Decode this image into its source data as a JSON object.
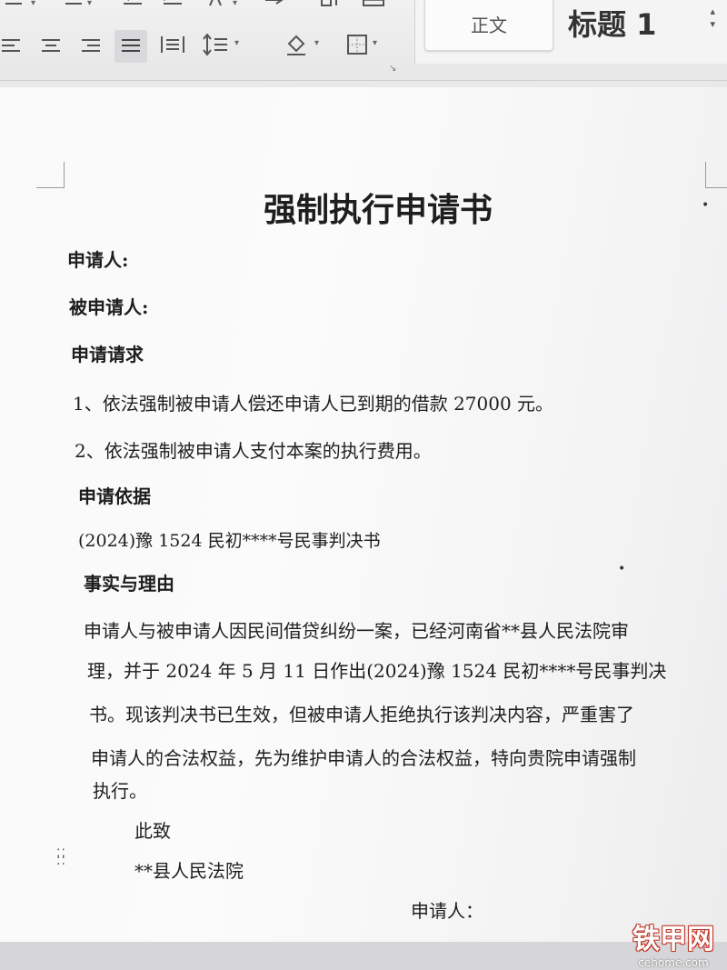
{
  "ribbon": {
    "styles": {
      "normal": "正文",
      "heading1": "标题 1"
    }
  },
  "document": {
    "title": "强制执行申请书",
    "applicant_label": "申请人:",
    "respondent_label": "被申请人:",
    "claims_heading": "申请请求",
    "claim_1": "1、依法强制被申请人偿还申请人已到期的借款 27000 元。",
    "claim_2": "2、依法强制被申请人支付本案的执行费用。",
    "basis_heading": "申请依据",
    "basis_text": "(2024)豫 1524 民初****号民事判决书",
    "facts_heading": "事实与理由",
    "facts_lines": [
      "申请人与被申请人因民间借贷纠纷一案，已经河南省**县人民法院审",
      "理，并于 2024 年 5 月 11 日作出(2024)豫 1524 民初****号民事判决",
      "书。现该判决书已生效，但被申请人拒绝执行该判决内容，严重害了",
      "申请人的合法权益，先为维护申请人的合法权益，特向贵院申请强制",
      "执行。"
    ],
    "closing": "此致",
    "court": "**县人民法院",
    "signature_label": "申请人："
  },
  "watermark": {
    "logo": "铁甲网",
    "url": "cehome.com"
  }
}
